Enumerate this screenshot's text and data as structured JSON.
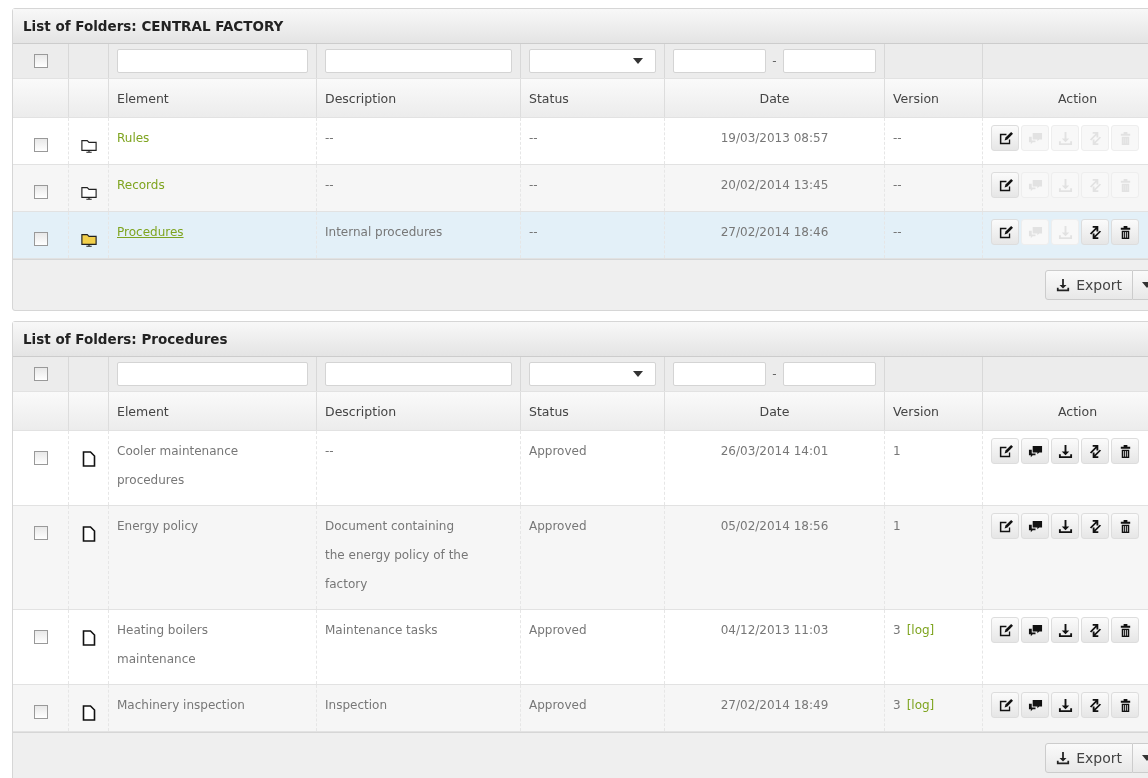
{
  "panels": [
    {
      "title": "List of Folders: CENTRAL FACTORY",
      "select_all": {
        "checked": false
      },
      "filters": {
        "date_separator": "-"
      },
      "columns": [
        "Element",
        "Description",
        "Status",
        "Date",
        "Version",
        "Action"
      ],
      "rows": [
        {
          "checked": false,
          "kind": "folder",
          "selected": false,
          "element": "Rules",
          "description": "--",
          "status": "--",
          "date": "19/03/2013 08:57",
          "version": "--",
          "actions": [
            {
              "kind": "edit",
              "enabled": true
            },
            {
              "kind": "comment",
              "enabled": false
            },
            {
              "kind": "download",
              "enabled": false
            },
            {
              "kind": "move",
              "enabled": false
            },
            {
              "kind": "delete",
              "enabled": false
            }
          ]
        },
        {
          "checked": false,
          "kind": "folder",
          "selected": false,
          "element": "Records",
          "description": "--",
          "status": "--",
          "date": "20/02/2014 13:45",
          "version": "--",
          "actions": [
            {
              "kind": "edit",
              "enabled": true
            },
            {
              "kind": "comment",
              "enabled": false
            },
            {
              "kind": "download",
              "enabled": false
            },
            {
              "kind": "move",
              "enabled": false
            },
            {
              "kind": "delete",
              "enabled": false
            }
          ]
        },
        {
          "checked": false,
          "kind": "folder",
          "selected": true,
          "element": "Procedures",
          "description": "Internal procedures",
          "status": "--",
          "date": "27/02/2014 18:46",
          "version": "--",
          "actions": [
            {
              "kind": "edit",
              "enabled": true
            },
            {
              "kind": "comment",
              "enabled": false
            },
            {
              "kind": "download",
              "enabled": false
            },
            {
              "kind": "move",
              "enabled": true
            },
            {
              "kind": "delete",
              "enabled": true
            }
          ]
        }
      ],
      "export": "Export"
    },
    {
      "title": "List of Folders: Procedures",
      "select_all": {
        "checked": false
      },
      "filters": {
        "date_separator": "-"
      },
      "columns": [
        "Element",
        "Description",
        "Status",
        "Date",
        "Version",
        "Action"
      ],
      "rows": [
        {
          "checked": false,
          "kind": "file",
          "element": "Cooler maintenance procedures",
          "description": "--",
          "status": "Approved",
          "date": "26/03/2014 14:01",
          "version": "1",
          "actions": [
            {
              "kind": "edit",
              "enabled": true
            },
            {
              "kind": "comment",
              "enabled": true
            },
            {
              "kind": "download",
              "enabled": true
            },
            {
              "kind": "move",
              "enabled": true
            },
            {
              "kind": "delete",
              "enabled": true
            }
          ]
        },
        {
          "checked": false,
          "kind": "file",
          "element": "Energy policy",
          "description": "Document containing the energy policy of the factory",
          "status": "Approved",
          "date": "05/02/2014 18:56",
          "version": "1",
          "actions": [
            {
              "kind": "edit",
              "enabled": true
            },
            {
              "kind": "comment",
              "enabled": true
            },
            {
              "kind": "download",
              "enabled": true
            },
            {
              "kind": "move",
              "enabled": true
            },
            {
              "kind": "delete",
              "enabled": true
            }
          ]
        },
        {
          "checked": false,
          "kind": "file",
          "element": "Heating boilers maintenance",
          "description": "Maintenance tasks",
          "status": "Approved",
          "date": "04/12/2013 11:03",
          "version": "3",
          "log": "[log]",
          "actions": [
            {
              "kind": "edit",
              "enabled": true
            },
            {
              "kind": "comment",
              "enabled": true
            },
            {
              "kind": "download",
              "enabled": true
            },
            {
              "kind": "move",
              "enabled": true
            },
            {
              "kind": "delete",
              "enabled": true
            }
          ]
        },
        {
          "checked": false,
          "kind": "file",
          "element": "Machinery inspection",
          "description": "Inspection",
          "status": "Approved",
          "date": "27/02/2014 18:49",
          "version": "3",
          "log": "[log]",
          "actions": [
            {
              "kind": "edit",
              "enabled": true
            },
            {
              "kind": "comment",
              "enabled": true
            },
            {
              "kind": "download",
              "enabled": true
            },
            {
              "kind": "move",
              "enabled": true
            },
            {
              "kind": "delete",
              "enabled": true
            }
          ]
        }
      ],
      "export": "Export"
    }
  ]
}
